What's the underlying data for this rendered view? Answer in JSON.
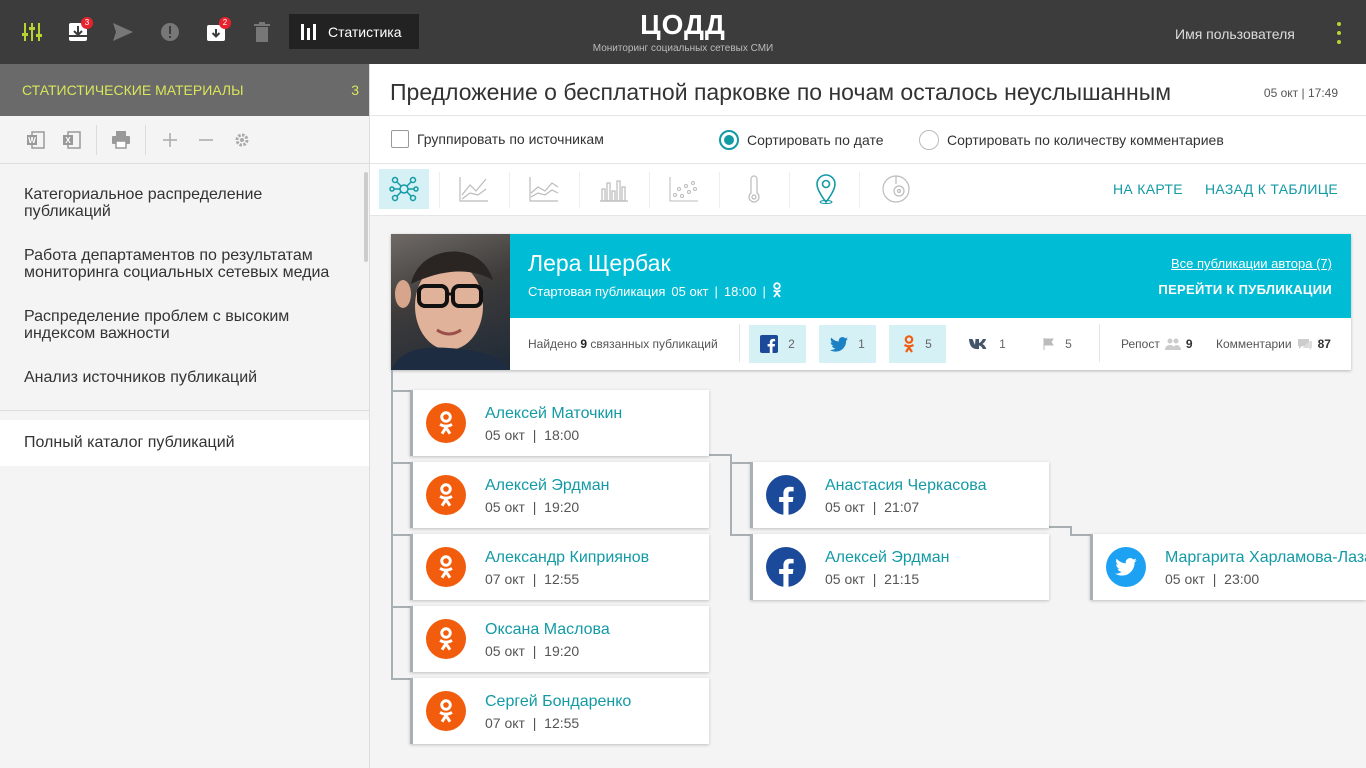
{
  "topbar": {
    "badges": {
      "inbox": "3",
      "archive": "2"
    },
    "stats_label": "Статистика",
    "brand_title": "ЦОДД",
    "brand_subtitle": "Мониторинг социальных сетевых СМИ",
    "user_name": "Имя пользователя"
  },
  "sidebar": {
    "header": "СТАТИСТИЧЕСКИЕ МАТЕРИАЛЫ",
    "header_count": "3",
    "items": [
      {
        "label": "Категориальное распределение публикаций"
      },
      {
        "label": "Работа департаментов по результатам мониторинга социальных сетевых медиа"
      },
      {
        "label": "Распределение проблем с высоким индексом важности"
      },
      {
        "label": "Анализ источников публикаций"
      }
    ],
    "catalog": "Полный каталог публикаций"
  },
  "main": {
    "title": "Предложение о бесплатной парковке по ночам осталось неуслышанным",
    "date": "05 окт",
    "time": "17:49",
    "options": {
      "group": "Группировать по источникам",
      "sort_date": "Сортировать по дате",
      "sort_comments": "Сортировать по количеству комментариев"
    },
    "on_map": "НА КАРТЕ",
    "back": "НАЗАД К ТАБЛИЦЕ"
  },
  "author": {
    "name": "Лера Щербак",
    "meta_label": "Стартовая публикация",
    "meta_date": "05 окт",
    "meta_time": "18:00",
    "all_link": "Все публикации автора (7)",
    "go_link": "ПЕРЕЙТИ К ПУБЛИКАЦИИ",
    "found_prefix": "Найдено",
    "found_count": "9",
    "found_suffix": "связанных публикаций",
    "fb_count": "2",
    "tw_count": "1",
    "ok_count": "5",
    "vk_count": "1",
    "flag_count": "5",
    "repost_label": "Репост",
    "repost_count": "9",
    "comments_label": "Комментарии",
    "comments_count": "87"
  },
  "publications": [
    {
      "name": "Алексей Маточкин",
      "date": "05 окт",
      "time": "18:00",
      "network": "ok"
    },
    {
      "name": "Алексей Эрдман",
      "date": "05 окт",
      "time": "19:20",
      "network": "ok"
    },
    {
      "name": "Александр Киприянов",
      "date": "07 окт",
      "time": "12:55",
      "network": "ok"
    },
    {
      "name": "Оксана Маслова",
      "date": "05 окт",
      "time": "19:20",
      "network": "ok"
    },
    {
      "name": "Сергей Бондаренко",
      "date": "07 окт",
      "time": "12:55",
      "network": "ok"
    },
    {
      "name": "Анастасия Черкасова",
      "date": "05 окт",
      "time": "21:07",
      "network": "fb"
    },
    {
      "name": "Алексей Эрдман",
      "date": "05 окт",
      "time": "21:15",
      "network": "fb"
    },
    {
      "name": "Маргарита Харламова-Лазарева",
      "date": "05 окт",
      "time": "23:00",
      "network": "tw"
    }
  ],
  "colors": {
    "accent": "#129aa5",
    "header_cyan": "#00bcd4",
    "sidebar_accent": "#d8e65a",
    "ok": "#f25c0d",
    "fb": "#1c4a9b",
    "tw": "#1da1f2"
  }
}
